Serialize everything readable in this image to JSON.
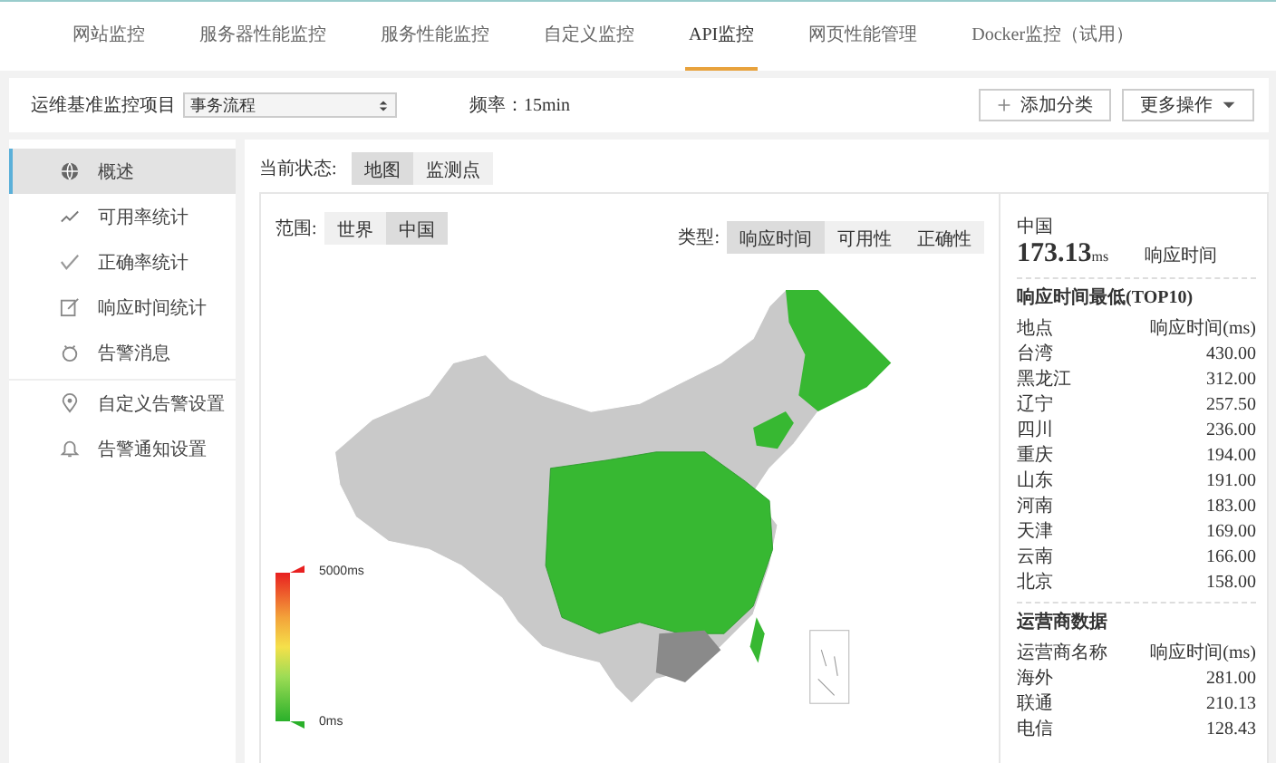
{
  "nav_tabs": [
    {
      "label": "网站监控",
      "selected": false
    },
    {
      "label": "服务器性能监控",
      "selected": false
    },
    {
      "label": "服务性能监控",
      "selected": false
    },
    {
      "label": "自定义监控",
      "selected": false
    },
    {
      "label": "API监控",
      "selected": true
    },
    {
      "label": "网页性能管理",
      "selected": false
    },
    {
      "label": "Docker监控（试用）",
      "selected": false
    }
  ],
  "toolbar": {
    "project_label": "运维基准监控项目",
    "project_select": "事务流程",
    "frequency": "频率：15min",
    "buttons": [
      {
        "label": "添加分类"
      },
      {
        "label": "更多操作"
      }
    ]
  },
  "sidebar": {
    "groups": [
      {
        "items": [
          {
            "label": "概述",
            "selected": true
          },
          {
            "label": "可用率统计",
            "selected": false
          },
          {
            "label": "正确率统计",
            "selected": false
          },
          {
            "label": "响应时间统计",
            "selected": false
          },
          {
            "label": "告警消息",
            "selected": false
          }
        ]
      },
      {
        "items": [
          {
            "label": "自定义告警设置",
            "selected": false
          },
          {
            "label": "告警通知设置",
            "selected": false
          }
        ]
      }
    ]
  },
  "status": {
    "label": "当前状态:",
    "options": [
      {
        "label": "地图",
        "selected": true
      },
      {
        "label": "监测点",
        "selected": false
      }
    ]
  },
  "map": {
    "scope_label": "范围:",
    "scopes": [
      {
        "label": "世界",
        "selected": false
      },
      {
        "label": "中国",
        "selected": true
      }
    ],
    "type_label": "类型:",
    "types": [
      {
        "label": "响应时间",
        "selected": true
      },
      {
        "label": "可用性",
        "selected": false
      },
      {
        "label": "正确性",
        "selected": false
      }
    ],
    "legend": {
      "max": "5000ms",
      "min": "0ms"
    }
  },
  "stats": {
    "region": "中国",
    "value": "173.13",
    "unit": "ms",
    "value_label": "响应时间",
    "top_title": "响应时间最低(TOP10)",
    "top_columns": [
      "地点",
      "响应时间(ms)"
    ],
    "top_rows": [
      [
        "台湾",
        "430.00"
      ],
      [
        "黑龙江",
        "312.00"
      ],
      [
        "辽宁",
        "257.50"
      ],
      [
        "四川",
        "236.00"
      ],
      [
        "重庆",
        "194.00"
      ],
      [
        "山东",
        "191.00"
      ],
      [
        "河南",
        "183.00"
      ],
      [
        "天津",
        "169.00"
      ],
      [
        "云南",
        "166.00"
      ],
      [
        "北京",
        "158.00"
      ]
    ],
    "isp_title": "运营商数据",
    "isp_columns": [
      "运营商名称",
      "响应时间(ms)"
    ],
    "isp_rows": [
      [
        "海外",
        "281.00"
      ],
      [
        "联通",
        "210.13"
      ],
      [
        "电信",
        "128.43"
      ]
    ]
  }
}
